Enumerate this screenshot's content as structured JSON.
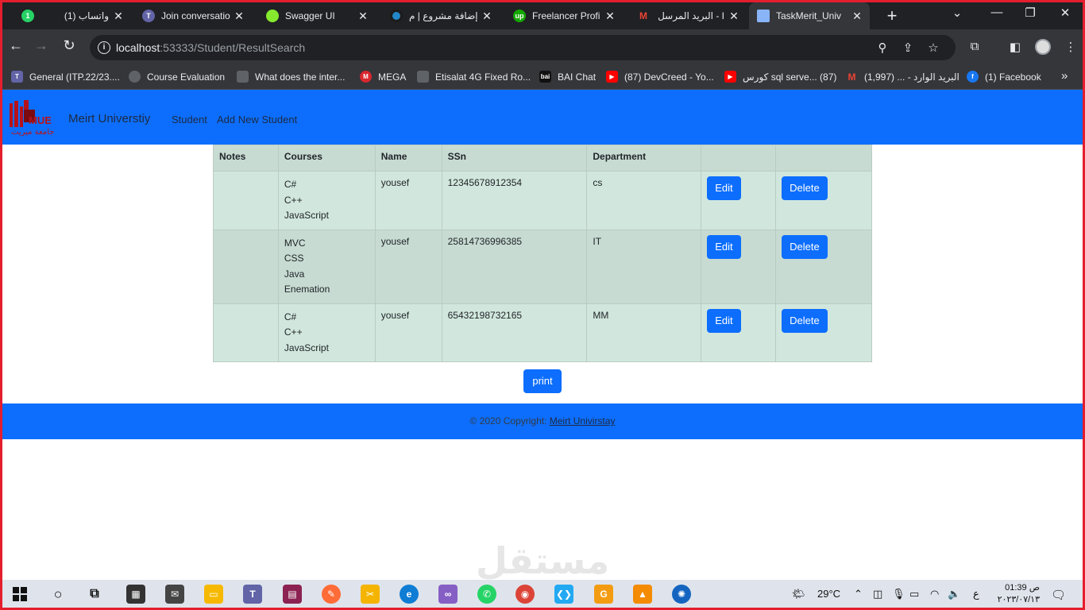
{
  "browser": {
    "tabs": [
      {
        "label": "(1) واتساب",
        "icon": "whatsapp-icon",
        "color": "#25d366",
        "badge": "1"
      },
      {
        "label": "Join conversatio",
        "icon": "teams-icon",
        "color": "#6264a7",
        "badge": ""
      },
      {
        "label": "Swagger UI",
        "icon": "swagger-icon",
        "color": "#85ea2d",
        "badge": ""
      },
      {
        "label": "إضافة مشروع | م",
        "icon": "mostaql-icon",
        "color": "#2386c8",
        "badge": ""
      },
      {
        "label": "Freelancer Profi",
        "icon": "upwork-icon",
        "color": "#14a800",
        "badge": "up"
      },
      {
        "label": "البريد المرسل - I",
        "icon": "gmail-icon",
        "color": "#ea4335",
        "badge": "M"
      },
      {
        "label": "TaskMerit_Univ",
        "icon": "page-icon",
        "color": "#8ab4f8",
        "badge": ""
      }
    ],
    "url_host": "localhost",
    "url_rest": ":53333/Student/ResultSearch",
    "bookmarks": [
      {
        "label": "General (ITP.22/23....",
        "icon": "teams-icon",
        "color": "#6264a7"
      },
      {
        "label": "Course Evaluation",
        "icon": "globe-icon",
        "color": "#5f6368"
      },
      {
        "label": "What does the inter...",
        "icon": "openai-icon",
        "color": "#5f6368"
      },
      {
        "label": "MEGA",
        "icon": "mega-icon",
        "color": "#d9272e"
      },
      {
        "label": "Etisalat 4G Fixed Ro...",
        "icon": "router-icon",
        "color": "#5f6368"
      },
      {
        "label": "BAI Chat",
        "icon": "bai-icon",
        "color": "#111111"
      },
      {
        "label": "(87) DevCreed - Yo...",
        "icon": "youtube-icon",
        "color": "#ff0000"
      },
      {
        "label": "كورس sql serve... (87)",
        "icon": "youtube-icon",
        "color": "#ff0000"
      },
      {
        "label": "البريد الوارد - ... (1,997)",
        "icon": "gmail-icon",
        "color": "#ea4335"
      },
      {
        "label": "(1) Facebook",
        "icon": "facebook-icon",
        "color": "#1877f2"
      }
    ]
  },
  "app": {
    "brand": "Meirt Universtiy",
    "nav": [
      "Student",
      "Add New Student"
    ],
    "table": {
      "headers": [
        "Notes",
        "Courses",
        "Name",
        "SSn",
        "Department",
        "",
        ""
      ],
      "rows": [
        {
          "notes": "",
          "courses": [
            "C#",
            "C++",
            "JavaScript"
          ],
          "name": "yousef",
          "ssn": "12345678912354",
          "department": "cs"
        },
        {
          "notes": "",
          "courses": [
            "MVC",
            "CSS",
            "Java",
            "Enemation"
          ],
          "name": "yousef",
          "ssn": "25814736996385",
          "department": "IT"
        },
        {
          "notes": "",
          "courses": [
            "C#",
            "C++",
            "JavaScript"
          ],
          "name": "yousef",
          "ssn": "65432198732165",
          "department": "MM"
        }
      ],
      "edit_label": "Edit",
      "delete_label": "Delete"
    },
    "print_label": "print",
    "footer_text": "© 2020 Copyright: ",
    "footer_link": "Meirt Univirstay"
  },
  "taskbar": {
    "weather": "29°C",
    "time": "ص 01:39",
    "date": "٢٠٢٣/٠٧/١٣",
    "lang": "ع",
    "apps": [
      {
        "icon": "start-icon",
        "color": "#0078d4"
      },
      {
        "icon": "search-icon",
        "color": "#222222"
      },
      {
        "icon": "task-view-icon",
        "color": "#333333"
      },
      {
        "icon": "store-icon",
        "color": "#333333"
      },
      {
        "icon": "mail-icon",
        "color": "#333333"
      },
      {
        "icon": "file-explorer-icon",
        "color": "#f6b900"
      },
      {
        "icon": "teams-icon",
        "color": "#6264a7"
      },
      {
        "icon": "winrar-icon",
        "color": "#8b2252"
      },
      {
        "icon": "postman-icon",
        "color": "#ff6c37"
      },
      {
        "icon": "tool-icon",
        "color": "#f4b400"
      },
      {
        "icon": "edge-icon",
        "color": "#0f7dd4"
      },
      {
        "icon": "visual-studio-icon",
        "color": "#865fc5"
      },
      {
        "icon": "whatsapp-icon",
        "color": "#25d366"
      },
      {
        "icon": "chrome-icon",
        "color": "#db4437"
      },
      {
        "icon": "vscode-icon",
        "color": "#23a9f2"
      },
      {
        "icon": "pdf-app-icon",
        "color": "#f39c12"
      },
      {
        "icon": "vlc-icon",
        "color": "#f48b00"
      },
      {
        "icon": "media-player-icon",
        "color": "#1565c0"
      }
    ]
  },
  "colors": {
    "primary": "#0d6efd",
    "row_light": "#d1e7dd",
    "row_dark": "#c7dbd2",
    "border": "#e41e2d"
  }
}
